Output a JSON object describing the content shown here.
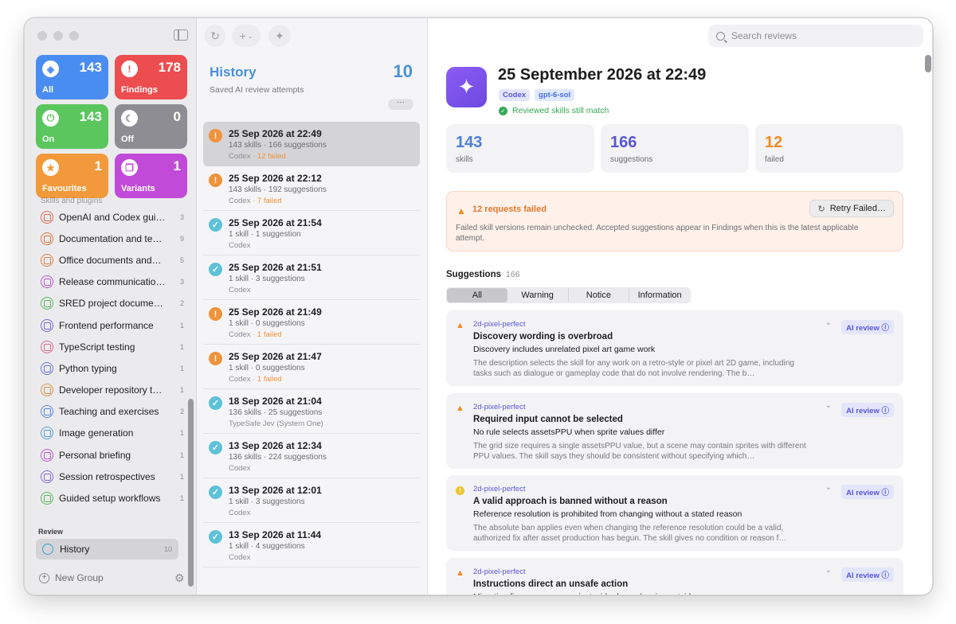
{
  "sidebar": {
    "tiles": [
      {
        "label": "All",
        "count": "143",
        "icon": "stack-icon",
        "glyph": "◈",
        "color": "#4a8df0"
      },
      {
        "label": "Findings",
        "count": "178",
        "icon": "warning-icon",
        "glyph": "!",
        "color": "#ec4d4f"
      },
      {
        "label": "On",
        "count": "143",
        "icon": "power-icon",
        "glyph": "⏻",
        "color": "#5ac65d"
      },
      {
        "label": "Off",
        "count": "0",
        "icon": "moon-icon",
        "glyph": "☾",
        "color": "#8d8d93"
      },
      {
        "label": "Favourites",
        "count": "1",
        "icon": "star-icon",
        "glyph": "★",
        "color": "#f29a3b"
      },
      {
        "label": "Variants",
        "count": "1",
        "icon": "copy-icon",
        "glyph": "❐",
        "color": "#c24ad9"
      }
    ],
    "partial_item": "Skills and plugins",
    "groups": [
      {
        "label": "OpenAI and Codex gui…",
        "count": "3",
        "color": "#e06a5a"
      },
      {
        "label": "Documentation and te…",
        "count": "9",
        "color": "#e07a4a"
      },
      {
        "label": "Office documents and…",
        "count": "5",
        "color": "#e0804a"
      },
      {
        "label": "Release communicatio…",
        "count": "3",
        "color": "#c05ad0"
      },
      {
        "label": "SRED project docume…",
        "count": "2",
        "color": "#5ab860"
      },
      {
        "label": "Frontend performance",
        "count": "1",
        "color": "#7a6ad8"
      },
      {
        "label": "TypeScript testing",
        "count": "1",
        "color": "#e06a8a"
      },
      {
        "label": "Python typing",
        "count": "1",
        "color": "#6a7ad8"
      },
      {
        "label": "Developer repository t…",
        "count": "1",
        "color": "#e0904a"
      },
      {
        "label": "Teaching and exercises",
        "count": "2",
        "color": "#5a8ad8"
      },
      {
        "label": "Image generation",
        "count": "1",
        "color": "#5aa0d8"
      },
      {
        "label": "Personal briefing",
        "count": "1",
        "color": "#c05ad0"
      },
      {
        "label": "Session retrospectives",
        "count": "1",
        "color": "#8a6ad8"
      },
      {
        "label": "Guided setup workflows",
        "count": "1",
        "color": "#5ab860"
      }
    ],
    "review_heading": "Review",
    "history": {
      "label": "History",
      "count": "10"
    },
    "new_group": "New Group"
  },
  "middle": {
    "title": "History",
    "count": "10",
    "subtitle": "Saved AI review attempts",
    "more": "···",
    "attempts": [
      {
        "title": "25 Sep 2026 at 22:49",
        "summary": "143 skills · 166 suggestions",
        "provider": "Codex",
        "failed": " · 12 failed",
        "status": "warn",
        "selected": true
      },
      {
        "title": "25 Sep 2026 at 22:12",
        "summary": "143 skills · 192 suggestions",
        "provider": "Codex",
        "failed": " · 7 failed",
        "status": "warn"
      },
      {
        "title": "25 Sep 2026 at 21:54",
        "summary": "1 skill · 1 suggestion",
        "provider": "Codex",
        "failed": "",
        "status": "ok"
      },
      {
        "title": "25 Sep 2026 at 21:51",
        "summary": "1 skill · 3 suggestions",
        "provider": "Codex",
        "failed": "",
        "status": "ok"
      },
      {
        "title": "25 Sep 2026 at 21:49",
        "summary": "1 skill · 0 suggestions",
        "provider": "Codex",
        "failed": " · 1 failed",
        "status": "warn"
      },
      {
        "title": "25 Sep 2026 at 21:47",
        "summary": "1 skill · 0 suggestions",
        "provider": "Codex",
        "failed": " · 1 failed",
        "status": "warn"
      },
      {
        "title": "18 Sep 2026 at 21:04",
        "summary": "136 skills · 25 suggestions",
        "provider": "TypeSafe Jev (System One)",
        "failed": "",
        "status": "ok"
      },
      {
        "title": "13 Sep 2026 at 12:34",
        "summary": "136 skills · 224 suggestions",
        "provider": "Codex",
        "failed": "",
        "status": "ok"
      },
      {
        "title": "13 Sep 2026 at 12:01",
        "summary": "1 skill · 3 suggestions",
        "provider": "Codex",
        "failed": "",
        "status": "ok"
      },
      {
        "title": "13 Sep 2026 at 11:44",
        "summary": "1 skill · 4 suggestions",
        "provider": "Codex",
        "failed": "",
        "status": "ok"
      }
    ]
  },
  "detail": {
    "search_placeholder": "Search reviews",
    "title": "25 September 2026 at 22:49",
    "chips": [
      "Codex",
      "gpt-6-sol"
    ],
    "match_text": "Reviewed skills still match",
    "stats": [
      {
        "value": "143",
        "label": "skills",
        "color": "#4a7fd9"
      },
      {
        "value": "166",
        "label": "suggestions",
        "color": "#5856d6"
      },
      {
        "value": "12",
        "label": "failed",
        "color": "#f08a24"
      }
    ],
    "alert": {
      "heading": "12 requests failed",
      "retry": "Retry Failed…",
      "body": "Failed skill versions remain unchecked. Accepted suggestions appear in Findings when this is the latest applicable attempt."
    },
    "suggestions_title": "Suggestions",
    "suggestions_count": "166",
    "segments": [
      "All",
      "Warning",
      "Notice",
      "Information"
    ],
    "ai_badge": "AI review ⓘ",
    "cards": [
      {
        "skill": "2d-pixel-perfect",
        "title": "Discovery wording is overbroad",
        "summary": "Discovery includes unrelated pixel art game work",
        "detail": "The description selects the skill for any work on a retro-style or pixel art 2D game, including tasks such as dialogue or gameplay code that do not involve rendering. The b…",
        "severity": "warning"
      },
      {
        "skill": "2d-pixel-perfect",
        "title": "Required input cannot be selected",
        "summary": "No rule selects assetsPPU when sprite values differ",
        "detail": "The grid size requires a single assetsPPU value, but a scene may contain sprites with different PPU values. The skill says they should be consistent without specifying which…",
        "severity": "warning"
      },
      {
        "skill": "2d-pixel-perfect",
        "title": "A valid approach is banned without a reason",
        "summary": "Reference resolution is prohibited from changing without a stated reason",
        "detail": "The absolute ban applies even when changing the reference resolution could be a valid, authorized fix after asset production has begun. The skill gives no condition or reason f…",
        "severity": "notice"
      },
      {
        "skill": "2d-pixel-perfect",
        "title": "Instructions direct an unsafe action",
        "summary": "Migration fix can remove project-wide dependencies outside scene scope",
        "detail": "",
        "severity": "warning"
      }
    ]
  }
}
